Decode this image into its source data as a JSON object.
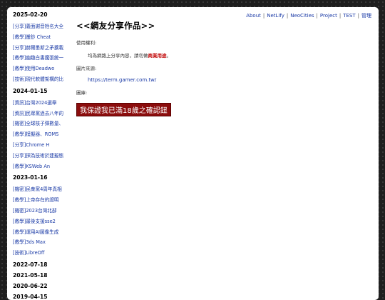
{
  "nav": {
    "items": [
      {
        "label": "About"
      },
      {
        "label": "NetLify"
      },
      {
        "label": "NeoCities"
      },
      {
        "label": "Project"
      },
      {
        "label": "TEST"
      },
      {
        "label": "管理"
      }
    ]
  },
  "sidebar": {
    "groups": [
      {
        "date": "2025-02-20",
        "entries": [
          {
            "label": "[分享]義面謝音姓名大全"
          },
          {
            "label": "[教學]叢鈔 Cheat"
          },
          {
            "label": "[分享]赫爾墨斯之矛擴載"
          },
          {
            "label": "[教學]幽趣白書魔張統一"
          },
          {
            "label": "[教學]使用Deadwo"
          },
          {
            "label": "[技術]現代軟體架構的比"
          }
        ]
      },
      {
        "date": "2024-01-15",
        "entries": [
          {
            "label": "[資訊]台灣2024選舉"
          },
          {
            "label": "[資訊]民眾黨過去八年的"
          },
          {
            "label": "[機密]全球核子彈數量、"
          },
          {
            "label": "[教學]模擬器、ROMS"
          },
          {
            "label": "[分享]Chrome H"
          },
          {
            "label": "[分享]探為技術於建擬態"
          },
          {
            "label": "[教學]KSWeb An"
          }
        ]
      },
      {
        "date": "2023-01-16",
        "entries": [
          {
            "label": "[機密]民衆黨4周年真相"
          },
          {
            "label": "[教學]上帝存在的證明"
          },
          {
            "label": "[機密]2023台灣北部"
          },
          {
            "label": "[教學]最後支援sse2"
          },
          {
            "label": "[教學]運用AI圖像生成"
          },
          {
            "label": "[教學]3ds Max"
          },
          {
            "label": "[技術]LibreOff"
          }
        ]
      },
      {
        "date": "2022-07-18",
        "entries": []
      },
      {
        "date": "2021-05-18",
        "entries": []
      },
      {
        "date": "2020-06-22",
        "entries": []
      },
      {
        "date": "2019-04-15",
        "entries": []
      }
    ]
  },
  "main": {
    "title": "<<網友分享作品>>",
    "terms_label": "使用權利:",
    "terms_text": "均為網路上分享內容，請勿做",
    "terms_highlight": "商業用途",
    "terms_end": "。",
    "source_label": "圖片來源:",
    "source_url": "https://term.gamer.com.tw/",
    "image_label": "圖庫:",
    "banner_text": "我保證我已滿18歲之確認鈕"
  },
  "colors": {
    "link": "#1a3aa6",
    "highlight": "#c00000",
    "banner_bg": "#8b0d0d"
  }
}
